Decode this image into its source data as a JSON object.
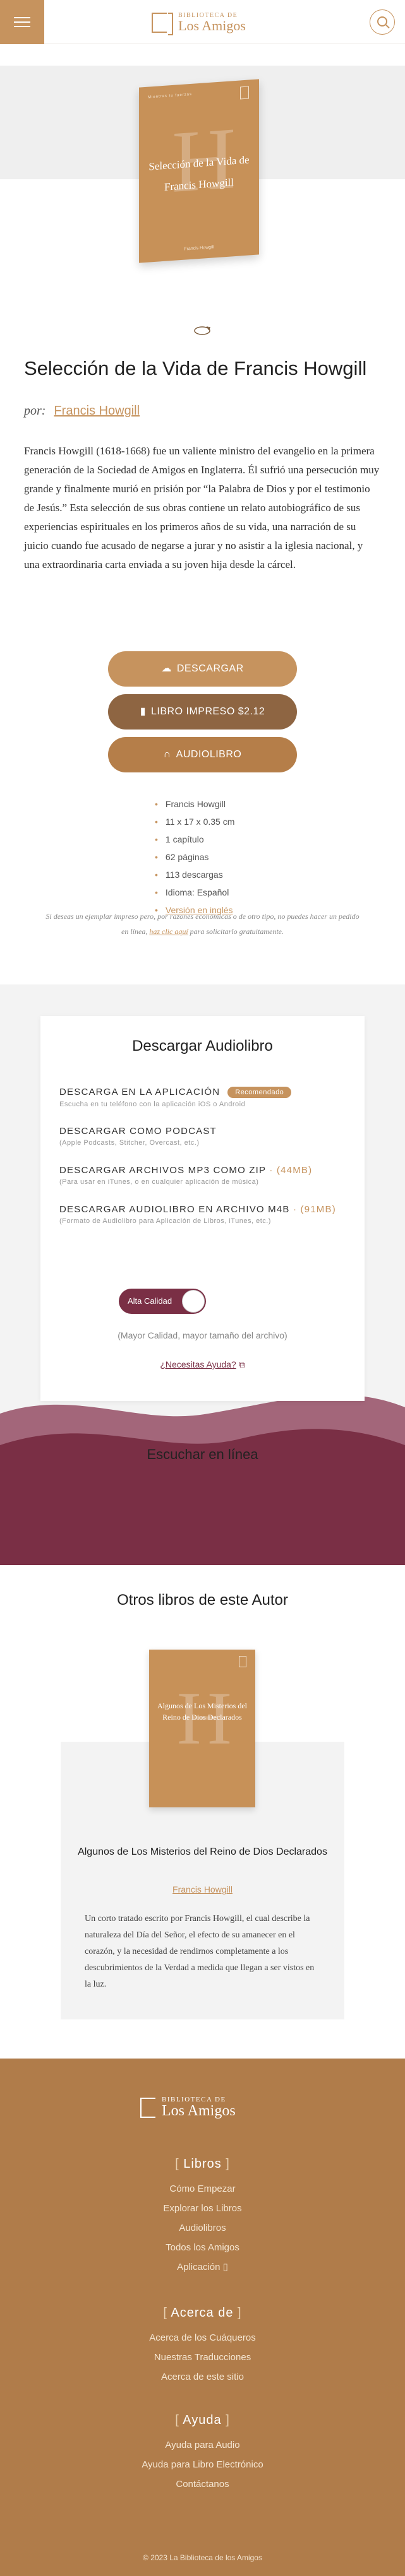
{
  "header": {
    "logo_small": "BIBLIOTECA DE",
    "logo_big": "Los Amigos"
  },
  "book": {
    "cover_small": "Mientras tu fuerzas",
    "cover_big_letter": "H",
    "cover_title": "Selección de la Vida de Francis Howgill",
    "cover_author": "Francis Howgill",
    "title": "Selección de la Vida de Francis Howgill",
    "by_label": "por:",
    "author": "Francis Howgill",
    "description": "Francis Howgill (1618-1668) fue un valiente ministro del evangelio en la primera generación de la Sociedad de Amigos en Inglaterra. Él sufrió una persecución muy grande y finalmente murió en prisión por “la Palabra de Dios y por el testimonio de Jesús.” Esta selección de sus obras contiene un relato autobiográfico de sus experiencias espirituales en los primeros años de su vida, una narración de su juicio cuando fue acusado de negarse a jurar y no asistir a la iglesia nacional, y una extraordinaria carta enviada a su joven hija desde la cárcel."
  },
  "buttons": {
    "download": "DESCARGAR",
    "print": "LIBRO IMPRESO $2.12",
    "audio": "AUDIOLIBRO"
  },
  "meta": [
    "Francis Howgill",
    "11 x 17 x 0.35 cm",
    "1 capítulo",
    "62 páginas",
    "113 descargas",
    "Idioma: Español",
    "Versión en inglés"
  ],
  "note": {
    "before": "Si deseas un ejemplar impreso pero, por razones económicas o de otro tipo, no puedes hacer un pedido en línea, ",
    "link": "haz clic aquí",
    "after": " para solicitarlo gratuitamente."
  },
  "audio": {
    "title": "Descargar Audiolibro",
    "options": [
      {
        "title": "DESCARGA EN LA APLICACIÓN",
        "badge": "Recomendado",
        "size": "",
        "sub": "Escucha en tu teléfono con la aplicación iOS o Android"
      },
      {
        "title": "DESCARGAR COMO PODCAST",
        "badge": "",
        "size": "",
        "sub": "(Apple Podcasts, Stitcher, Overcast, etc.)"
      },
      {
        "title": "DESCARGAR ARCHIVOS MP3 COMO ZIP",
        "badge": "",
        "size": " · (44MB)",
        "sub": "(Para usar en iTunes, o en cualquier aplicación de música)"
      },
      {
        "title": "DESCARGAR AUDIOLIBRO EN ARCHIVO M4B",
        "badge": "",
        "size": " · (91MB)",
        "sub": "(Formato de Audiolibro para Aplicación de Libros, iTunes, etc.)"
      }
    ],
    "quality": "Alta Calidad",
    "quality_note": "(Mayor Calidad, mayor tamaño del archivo)",
    "help": "¿Necesitas Ayuda?",
    "listen": "Escuchar en línea"
  },
  "others": {
    "title": "Otros libros de este Autor",
    "cover_title": "Algunos de Los Misterios del Reino de Dios Declarados",
    "name": "Algunos de Los Misterios del Reino de Dios Declarados",
    "author": "Francis Howgill",
    "desc": "Un corto tratado escrito por Francis Howgill, el cual describe la naturaleza del Día del Señor, el efecto de su amanecer en el corazón, y la necesidad de rendirnos completamente a los descubrimientos de la Verdad a medida que llegan a ser vistos en la luz."
  },
  "footer": {
    "logo_small": "BIBLIOTECA DE",
    "logo_big": "Los Amigos",
    "sections": [
      {
        "title": "Libros",
        "items": [
          "Cómo Empezar",
          "Explorar los Libros",
          "Audiolibros",
          "Todos los Amigos",
          "Aplicación"
        ]
      },
      {
        "title": "Acerca de",
        "items": [
          "Acerca de los Cuáqueros",
          "Nuestras Traducciones",
          "Acerca de este sitio"
        ]
      },
      {
        "title": "Ayuda",
        "items": [
          "Ayuda para Audio",
          "Ayuda para Libro Electrónico",
          "Contáctanos"
        ]
      }
    ],
    "copyright": "© 2023 La Biblioteca de los Amigos"
  },
  "colors": {
    "accent": "#c6935e",
    "wine": "#7a2f45",
    "footer": "#b07c4a"
  }
}
